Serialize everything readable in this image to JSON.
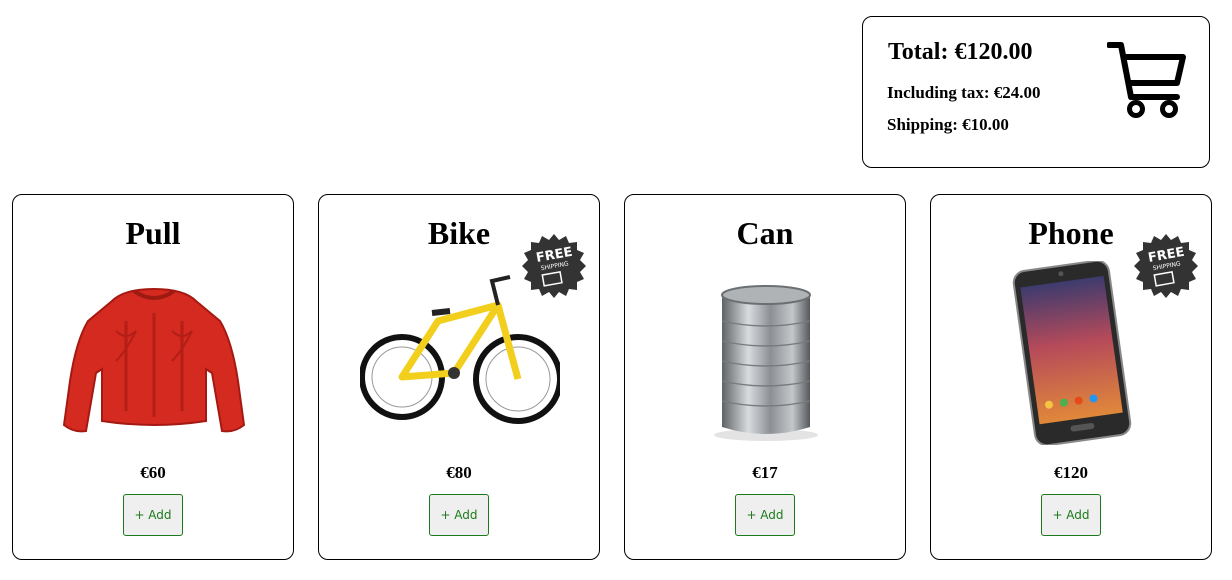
{
  "cart": {
    "total": "Total: €120.00",
    "tax": "Including tax: €24.00",
    "shipping": "Shipping: €10.00",
    "icon": "shopping-cart-icon"
  },
  "products": [
    {
      "name": "Pull",
      "price": "€60",
      "add_label": "+ Add",
      "free_shipping": false,
      "image": "red-sweater"
    },
    {
      "name": "Bike",
      "price": "€80",
      "add_label": "+ Add",
      "free_shipping": true,
      "image": "yellow-bicycle"
    },
    {
      "name": "Can",
      "price": "€17",
      "add_label": "+ Add",
      "free_shipping": false,
      "image": "tin-can"
    },
    {
      "name": "Phone",
      "price": "€120",
      "add_label": "+ Add",
      "free_shipping": true,
      "image": "smartphone"
    }
  ],
  "badge": {
    "line1": "FREE",
    "line2": "SHIPPING"
  },
  "colors": {
    "button_text": "#1c7a1c",
    "button_bg": "#efefef",
    "sweater": "#d42a20",
    "bike_frame": "#f2cf1c",
    "badge": "#333333"
  }
}
